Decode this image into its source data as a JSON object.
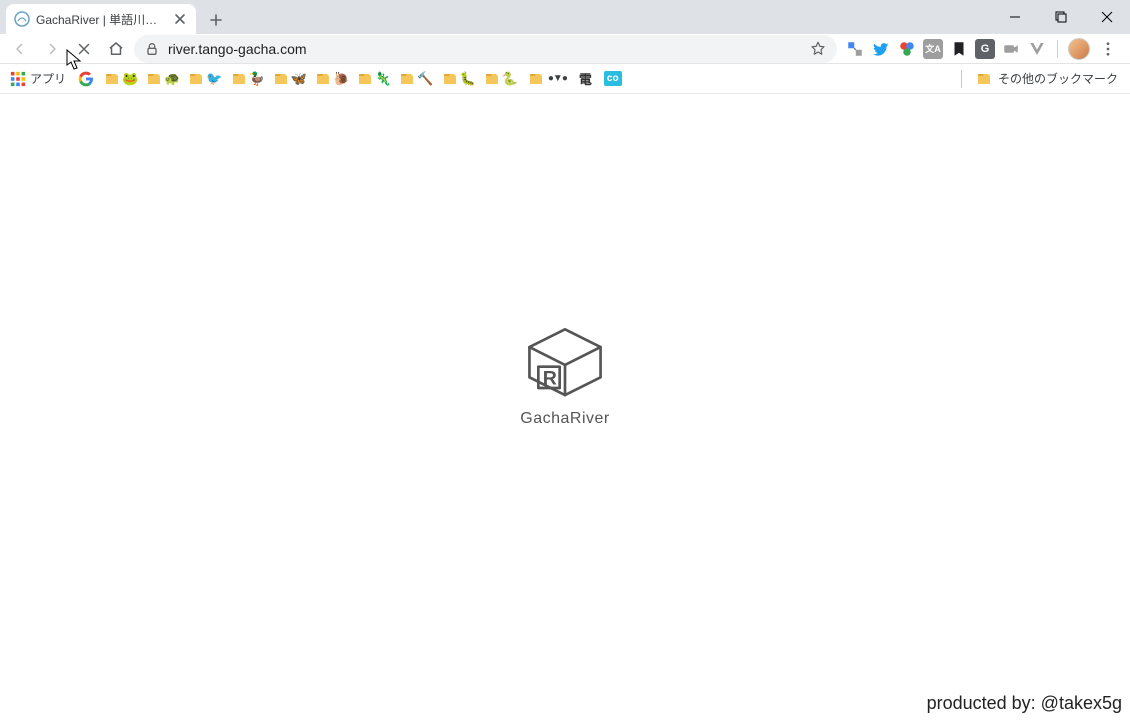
{
  "tab": {
    "title": "GachaRiver | 単語川を眺めて心を…"
  },
  "omnibox": {
    "url_display": "river.tango-gacha.com"
  },
  "bookmarks": {
    "apps_label": "アプリ",
    "other_label": "その他のブックマーク",
    "folder_emojis": [
      "🐸",
      "🐢",
      "🐦",
      "🦆",
      "🦋",
      "🐌",
      "🦎",
      "🔨",
      "🐛",
      "🐍"
    ],
    "shapes_item": "●▼●",
    "den_item": "電",
    "co_item": "co"
  },
  "ext": {
    "g_badge": "G"
  },
  "page": {
    "logo_text": "GachaRiver",
    "credit_prefix": "producted by: ",
    "credit_handle": "@takex5g"
  }
}
